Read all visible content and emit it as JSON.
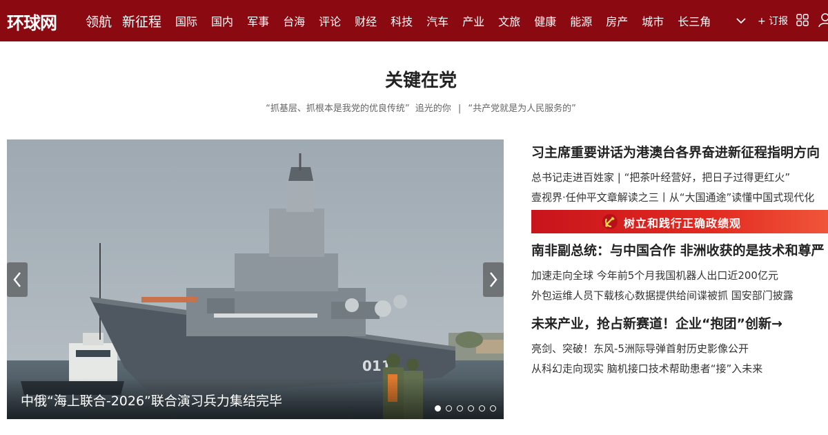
{
  "site": {
    "logo": "环球网"
  },
  "nav": {
    "primary": [
      "领航",
      "新征程"
    ],
    "items": [
      "国际",
      "国内",
      "军事",
      "台海",
      "评论",
      "财经",
      "科技",
      "汽车",
      "产业",
      "文旅",
      "健康",
      "能源",
      "房产",
      "城市",
      "长三角"
    ],
    "subscribe": "+ 订报",
    "icons": {
      "more": "chevron-down-icon",
      "grid": "grid-icon",
      "user": "user-icon"
    }
  },
  "section": {
    "title": "关键在党",
    "links": [
      "“抓基层、抓根本是我党的优良传统”",
      "追光的你",
      "“共产党就是为人民服务的”"
    ],
    "separator": "|"
  },
  "carousel": {
    "caption": "中俄“海上联合-2026”联合演习兵力集结完毕",
    "slide_count": 6,
    "active_index": 0,
    "image_subject": "warship-photo",
    "hull_number": "011"
  },
  "news": {
    "block1": {
      "headline": "习主席重要讲话为港澳台各界奋进新征程指明方向",
      "lines": [
        "总书记走进百姓家 | “把茶叶经营好，把日子过得更红火”",
        "壹视界·任仲平文章解读之三丨从“大国通途”读懂中国式现代化"
      ]
    },
    "banner": {
      "text": "树立和践行正确政绩观",
      "icon": "party-emblem-icon"
    },
    "block2": {
      "headline": "南非副总统：与中国合作 非洲收获的是技术和尊严",
      "lines": [
        "加速走向全球 今年前5个月我国机器人出口近200亿元",
        "外包运维人员下载核心数据提供给间谍被抓 国安部门披露"
      ]
    },
    "block3": {
      "headline": "未来产业，抢占新赛道！企业“抱团”创新→",
      "lines": [
        "亮剑、突破！东风-5洲际导弹首射历史影像公开",
        "从科幻走向现实 脑机接口技术帮助患者“接”入未来"
      ]
    }
  },
  "colors": {
    "nav_bg": "#8b0a12",
    "banner_red": "#d8201e",
    "text": "#222222"
  }
}
